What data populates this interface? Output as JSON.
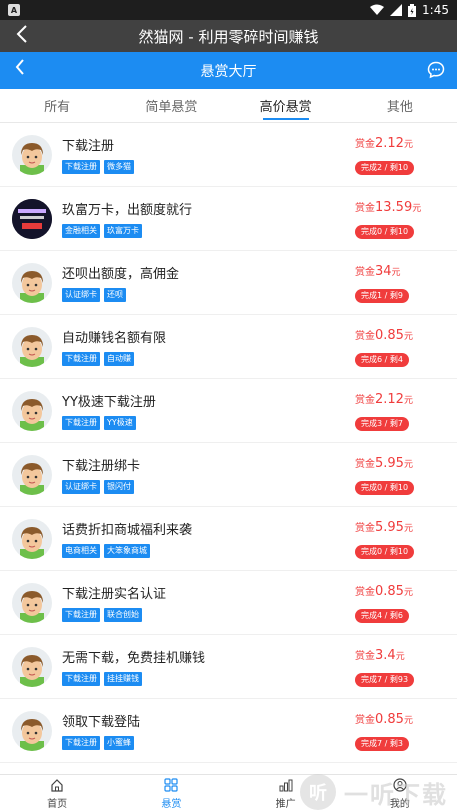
{
  "statusbar": {
    "time": "1:45",
    "app_icon": "A"
  },
  "app_title": "然猫网 - 利用零碎时间赚钱",
  "header": {
    "title": "悬赏大厅"
  },
  "tabs": [
    {
      "label": "所有"
    },
    {
      "label": "简单悬赏"
    },
    {
      "label": "高价悬赏"
    },
    {
      "label": "其他"
    }
  ],
  "active_tab": 2,
  "reward_prefix": "赏金",
  "reward_unit": "元",
  "tasks": [
    {
      "title": "下载注册",
      "tags": [
        "下载注册",
        "微多猫"
      ],
      "amount": "2.12",
      "status": "完成2 / 剩10",
      "avatar": "cartoon-boy"
    },
    {
      "title": "玖富万卡，出额度就行",
      "tags": [
        "金融相关",
        "玖富万卡"
      ],
      "amount": "13.59",
      "status": "完成0 / 剩10",
      "avatar": "dark-promo"
    },
    {
      "title": "还呗出额度，高佣金",
      "tags": [
        "认证绑卡",
        "还呗"
      ],
      "amount": "34",
      "status": "完成1 / 剩9",
      "avatar": "cartoon-boy"
    },
    {
      "title": "自动赚钱名额有限",
      "tags": [
        "下载注册",
        "自动赚"
      ],
      "amount": "0.85",
      "status": "完成6 / 剩4",
      "avatar": "cartoon-boy"
    },
    {
      "title": "YY极速下载注册",
      "tags": [
        "下载注册",
        "YY极速"
      ],
      "amount": "2.12",
      "status": "完成3 / 剩7",
      "avatar": "cartoon-boy"
    },
    {
      "title": "下载注册绑卡",
      "tags": [
        "认证绑卡",
        "银闪付"
      ],
      "amount": "5.95",
      "status": "完成0 / 剩10",
      "avatar": "cartoon-boy"
    },
    {
      "title": "话费折扣商城福利来袭",
      "tags": [
        "电商相关",
        "大笨象商城"
      ],
      "amount": "5.95",
      "status": "完成0 / 剩10",
      "avatar": "cartoon-boy"
    },
    {
      "title": "下载注册实名认证",
      "tags": [
        "下载注册",
        "联合创始"
      ],
      "amount": "0.85",
      "status": "完成4 / 剩6",
      "avatar": "cartoon-boy"
    },
    {
      "title": "无需下载，免费挂机赚钱",
      "tags": [
        "下载注册",
        "挂挂赚钱"
      ],
      "amount": "3.4",
      "status": "完成7 / 剩93",
      "avatar": "cartoon-boy"
    },
    {
      "title": "领取下载登陆",
      "tags": [
        "下载注册",
        "小蜜蜂"
      ],
      "amount": "0.85",
      "status": "完成7 / 剩3",
      "avatar": "cartoon-boy"
    }
  ],
  "bottom_nav": [
    {
      "label": "首页",
      "icon": "home-icon"
    },
    {
      "label": "悬赏",
      "icon": "grid-icon"
    },
    {
      "label": "推广",
      "icon": "bar-chart-icon"
    },
    {
      "label": "我的",
      "icon": "user-icon"
    }
  ],
  "active_nav": 1,
  "watermark": {
    "glyph": "听",
    "text": "一听下载"
  },
  "colors": {
    "accent": "#1c8cf2",
    "reward": "#f03c3c",
    "titlebar": "#414141"
  }
}
